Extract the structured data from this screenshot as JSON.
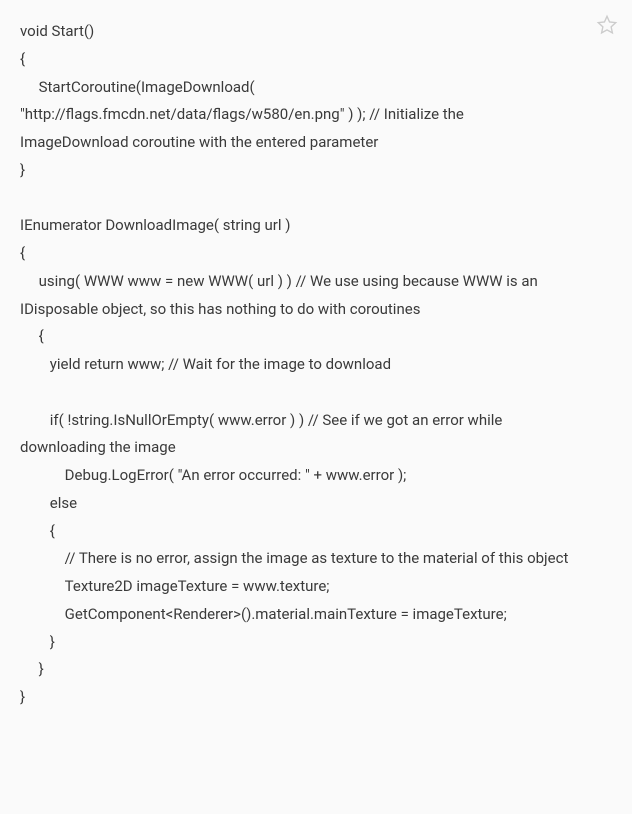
{
  "code": {
    "line1": "void Start()",
    "line2": "{",
    "line3": "     StartCoroutine(ImageDownload( \"http://flags.fmcdn.net/data/flags/w580/en.png\" ) ); // Initialize the ImageDownload coroutine with the entered parameter",
    "line4": "}",
    "line5": "",
    "line6": "IEnumerator DownloadImage( string url )",
    "line7": "{",
    "line8": "     using( WWW www = new WWW( url ) ) // We use using because WWW is an IDisposable object, so this has nothing to do with coroutines",
    "line9": "     {",
    "line10": "        yield return www; // Wait for the image to download",
    "line11": "",
    "line12": "        if( !string.IsNullOrEmpty( www.error ) ) // See if we got an error while downloading the image",
    "line13": "            Debug.LogError( \"An error occurred: \" + www.error );",
    "line14": "        else",
    "line15": "        {",
    "line16": "            // There is no error, assign the image as texture to the material of this object",
    "line17": "            Texture2D imageTexture = www.texture;",
    "line18": "            GetComponent<Renderer>().material.mainTexture = imageTexture;",
    "line19": "        }",
    "line20": "     }",
    "line21": "}"
  }
}
